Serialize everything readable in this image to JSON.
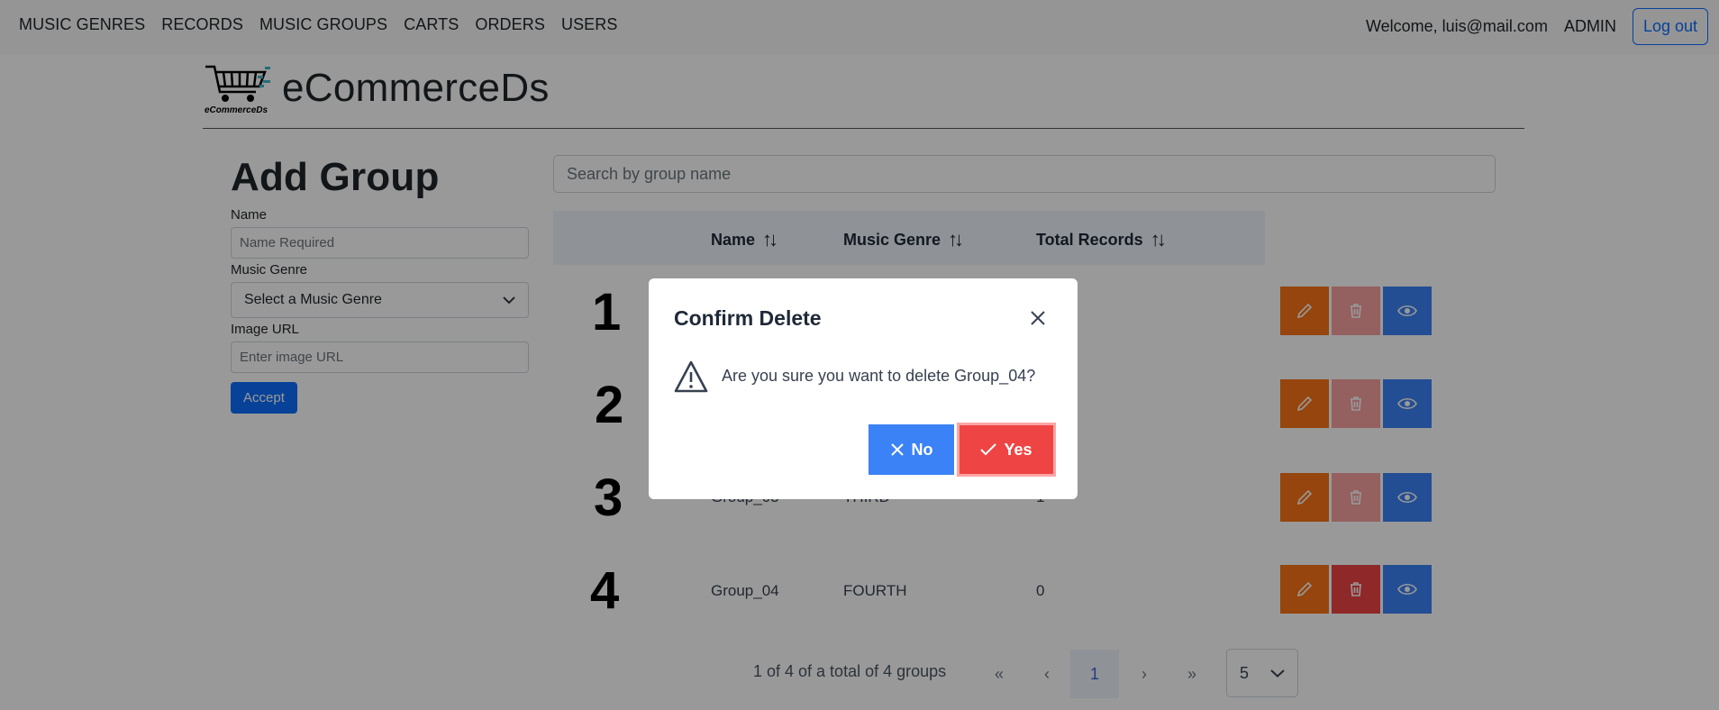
{
  "nav": {
    "links": [
      "MUSIC GENRES",
      "RECORDS",
      "MUSIC GROUPS",
      "CARTS",
      "ORDERS",
      "USERS"
    ],
    "welcome": "Welcome, luis@mail.com",
    "role": "ADMIN",
    "logout_label": "Log out"
  },
  "brand": {
    "title": "eCommerceDs",
    "logo_caption": "eCommerceDs"
  },
  "form": {
    "heading": "Add Group",
    "name_label": "Name",
    "name_placeholder": "Name Required",
    "genre_label": "Music Genre",
    "genre_value": "Select a Music Genre",
    "image_label": "Image URL",
    "image_placeholder": "Enter image URL",
    "accept_label": "Accept"
  },
  "table": {
    "search_placeholder": "Search by group name",
    "columns": [
      "Name",
      "Music Genre",
      "Total Records"
    ],
    "rows": [
      {
        "num": "1",
        "name": "",
        "genre": "",
        "records": "",
        "delete_enabled": false
      },
      {
        "num": "2",
        "name": "",
        "genre": "",
        "records": "",
        "delete_enabled": false
      },
      {
        "num": "3",
        "name": "Group_03",
        "genre": "THIRD",
        "records": "1",
        "delete_enabled": false
      },
      {
        "num": "4",
        "name": "Group_04",
        "genre": "FOURTH",
        "records": "0",
        "delete_enabled": true
      }
    ]
  },
  "pagination": {
    "summary": "1 of 4 of a total of 4 groups",
    "first": "«",
    "prev": "‹",
    "current_page": "1",
    "next": "›",
    "last": "»",
    "per_page": "5"
  },
  "modal": {
    "title": "Confirm Delete",
    "message": "Are you sure you want to delete Group_04?",
    "no_label": "No",
    "yes_label": "Yes"
  },
  "colors": {
    "primary": "#0d6efd",
    "edit": "#f97316",
    "delete": "#ef4444",
    "view": "#3b82f6"
  }
}
